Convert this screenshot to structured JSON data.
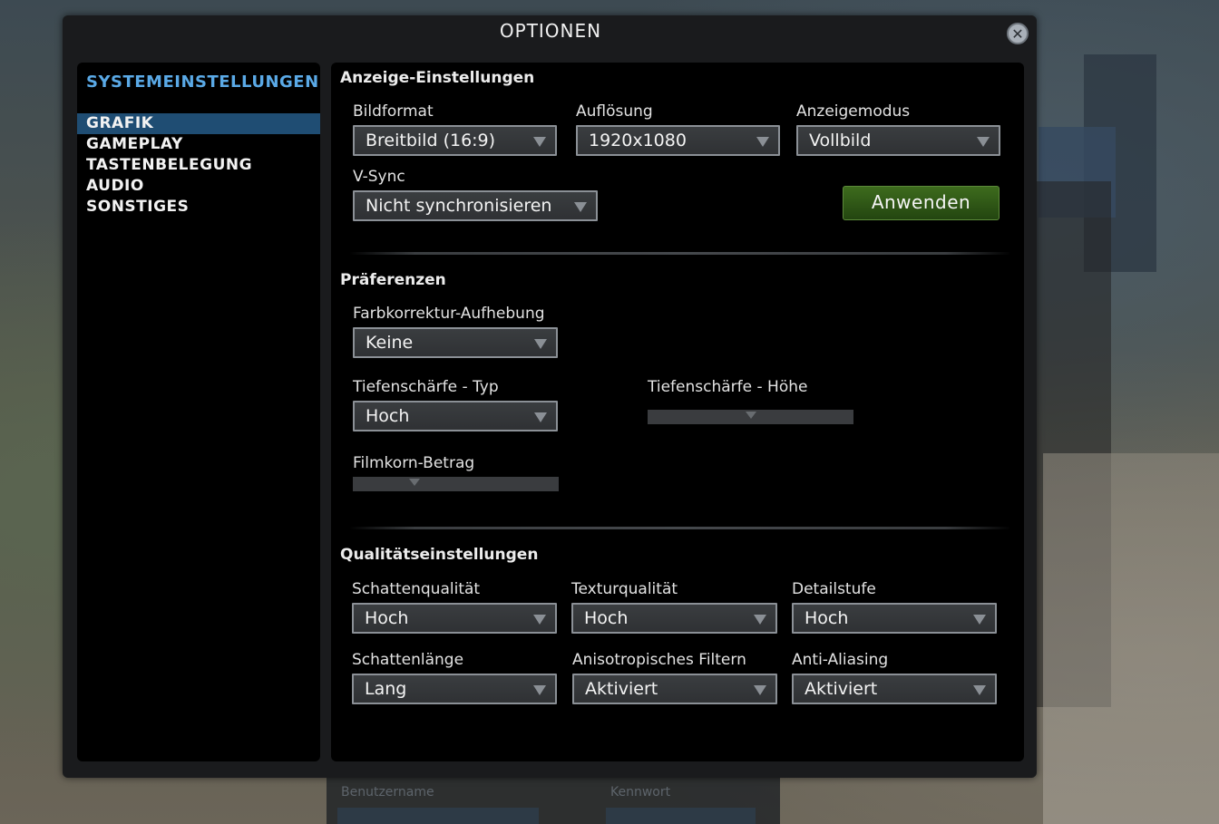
{
  "dialog": {
    "title": "OPTIONEN"
  },
  "sidebar": {
    "header": "SYSTEMEINSTELLUNGEN",
    "items": [
      {
        "label": "GRAFIK",
        "active": true
      },
      {
        "label": "GAMEPLAY",
        "active": false
      },
      {
        "label": "TASTENBELEGUNG",
        "active": false
      },
      {
        "label": "AUDIO",
        "active": false
      },
      {
        "label": "SONSTIGES",
        "active": false
      }
    ]
  },
  "display": {
    "title": "Anzeige-Einstellungen",
    "aspect_label": "Bildformat",
    "aspect_value": "Breitbild (16:9)",
    "resolution_label": "Auflösung",
    "resolution_value": "1920x1080",
    "mode_label": "Anzeigemodus",
    "mode_value": "Vollbild",
    "vsync_label": "V-Sync",
    "vsync_value": "Nicht synchronisieren",
    "apply_label": "Anwenden"
  },
  "preferences": {
    "title": "Präferenzen",
    "color_correction_label": "Farbkorrektur-Aufhebung",
    "color_correction_value": "Keine",
    "dof_type_label": "Tiefenschärfe - Typ",
    "dof_type_value": "Hoch",
    "dof_amount_label": "Tiefenschärfe - Höhe",
    "dof_amount_level": 0.5,
    "film_grain_label": "Filmkorn-Betrag",
    "film_grain_level": 0.3
  },
  "quality": {
    "title": "Qualitätseinstellungen",
    "shadow_quality_label": "Schattenqualität",
    "shadow_quality_value": "Hoch",
    "texture_quality_label": "Texturqualität",
    "texture_quality_value": "Hoch",
    "detail_label": "Detailstufe",
    "detail_value": "Hoch",
    "shadow_length_label": "Schattenlänge",
    "shadow_length_value": "Lang",
    "aniso_label": "Anisotropisches Filtern",
    "aniso_value": "Aktiviert",
    "aa_label": "Anti-Aliasing",
    "aa_value": "Aktiviert"
  },
  "background": {
    "username_label": "Benutzername",
    "password_label": "Kennwort"
  }
}
